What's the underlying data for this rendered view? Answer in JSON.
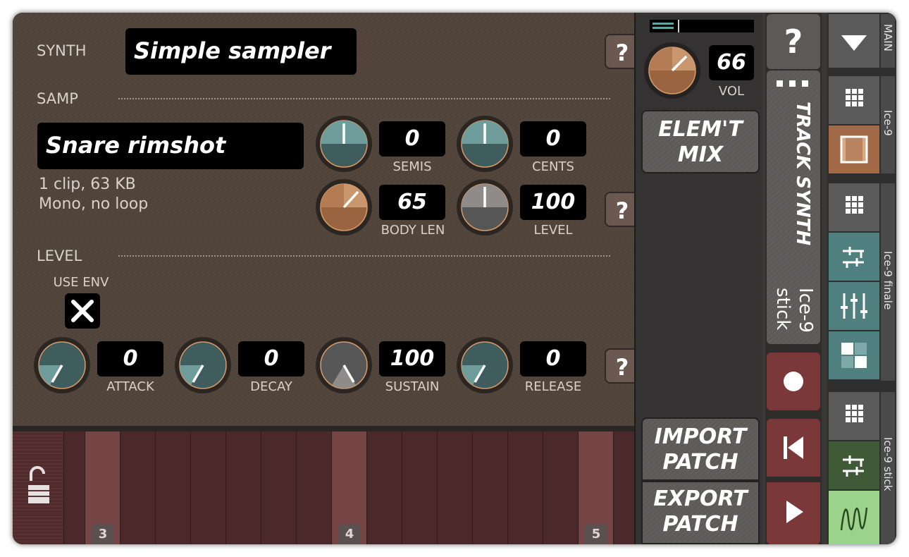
{
  "editor": {
    "synth_label": "SYNTH",
    "synth_name": "Simple  sampler",
    "samp_label": "SAMP",
    "sample_name": "Snare  rimshot",
    "sample_info_1": "1 clip, 63 KB",
    "sample_info_2": "Mono, no loop",
    "level_label": "LEVEL",
    "use_env_label": "USE ENV",
    "use_env_checked": true,
    "help_label": "?",
    "knobs": {
      "semis": {
        "label": "SEMIS",
        "value": "0"
      },
      "cents": {
        "label": "CENTS",
        "value": "0"
      },
      "body_len": {
        "label": "BODY LEN",
        "value": "65"
      },
      "level": {
        "label": "LEVEL",
        "value": "100"
      },
      "attack": {
        "label": "ATTACK",
        "value": "0"
      },
      "decay": {
        "label": "DECAY",
        "value": "0"
      },
      "sustain": {
        "label": "SUSTAIN",
        "value": "100"
      },
      "release": {
        "label": "RELEASE",
        "value": "0"
      }
    }
  },
  "keyboard": {
    "octave_labels": [
      "3",
      "4",
      "5"
    ]
  },
  "mixer": {
    "vol_label": "VOL",
    "vol_value": "66",
    "elem_mix_label_1": "ELEM'T",
    "elem_mix_label_2": "MIX",
    "import_label_1": "IMPORT",
    "import_label_2": "PATCH",
    "export_label_1": "EXPORT",
    "export_label_2": "PATCH"
  },
  "track": {
    "help_label": "?",
    "track_synth_label": "TRACK SYNTH",
    "track_name_1": "Ice-9",
    "track_name_2": "stick"
  },
  "strip": {
    "tabs": [
      "MAIN",
      "Ice-9",
      "Ice-9 finale",
      "Ice-9 stick"
    ]
  },
  "colors": {
    "accent_teal": "#4f7f7e",
    "accent_copper": "#a26a46",
    "record_red": "#7a3838",
    "strip_green": "#9cd38a"
  }
}
